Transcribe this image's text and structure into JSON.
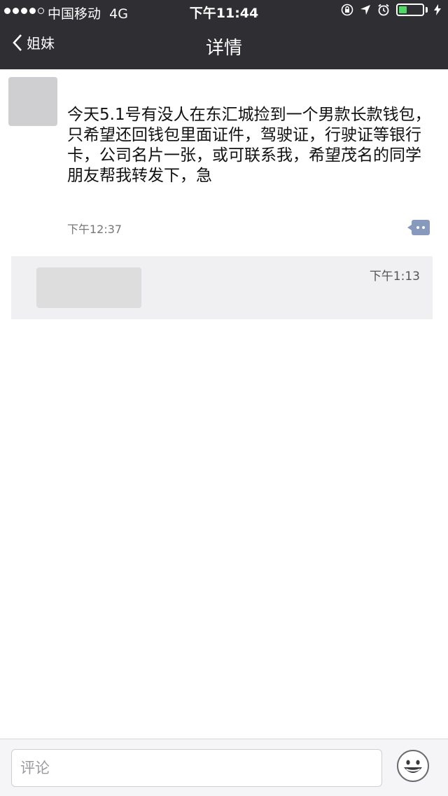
{
  "status_bar": {
    "carrier": "中国移动",
    "network": "4G",
    "time": "下午11:44",
    "signal_dots": [
      true,
      true,
      true,
      true,
      false
    ],
    "battery_level": 0.35
  },
  "nav": {
    "back_label": "姐妹",
    "title": "详情"
  },
  "post": {
    "text": "今天5.1号有没人在东汇城捡到一个男款长款钱包，只希望还回钱包里面证件，驾驶证，行驶证等银行卡，公司名片一张，或可联系我，希望茂名的同学朋友帮我转发下，急",
    "time": "下午12:37"
  },
  "comment": {
    "time": "下午1:13"
  },
  "input": {
    "placeholder": "评论"
  },
  "colors": {
    "nav_bg": "#2f2f33",
    "comment_button": "#8799bd",
    "battery": "#4cd964"
  }
}
